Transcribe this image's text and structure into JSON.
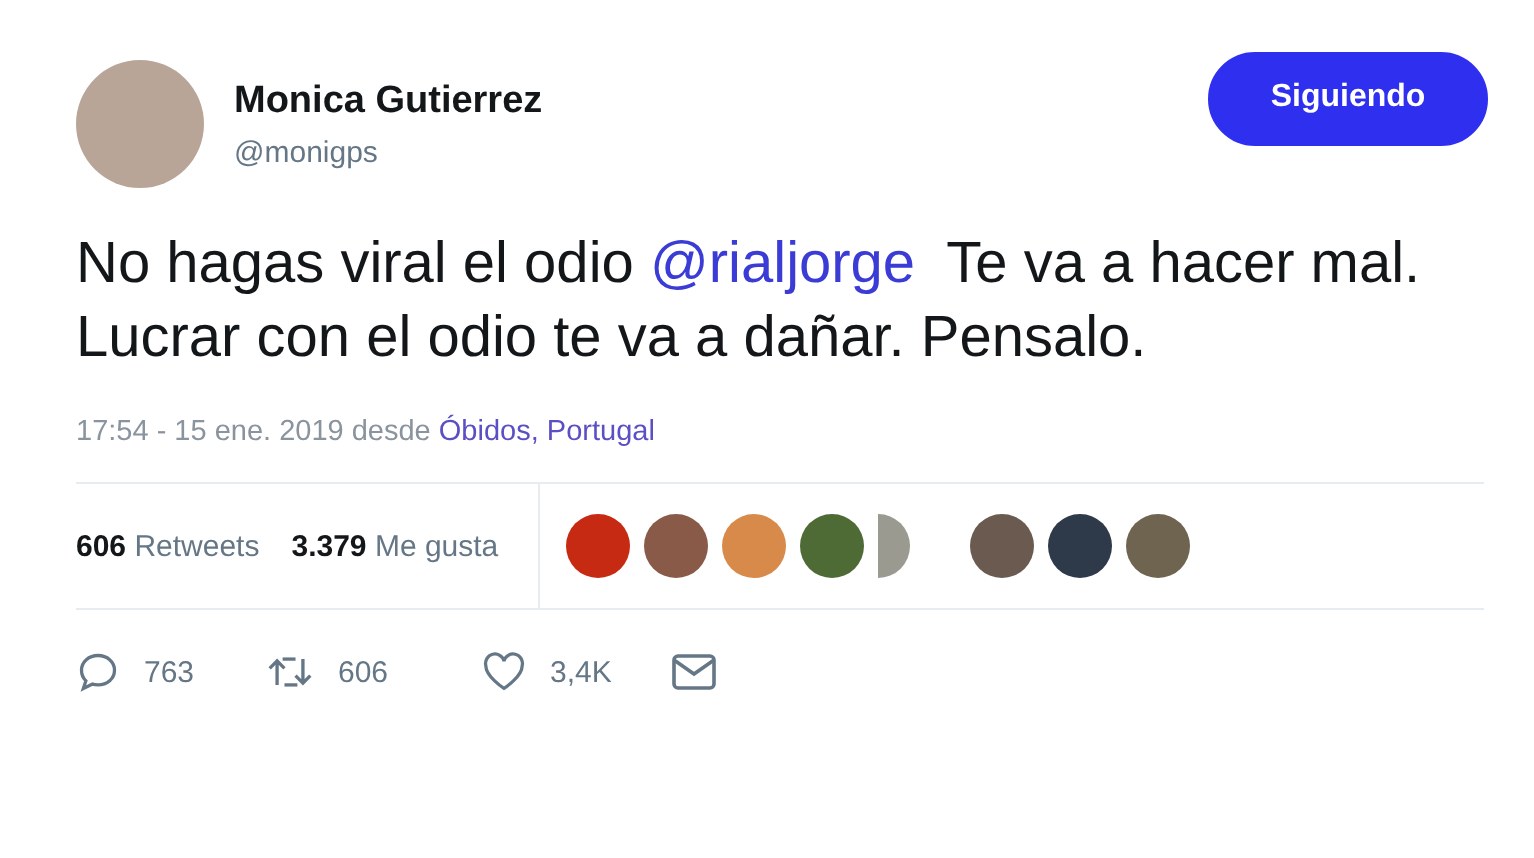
{
  "author": {
    "name": "Monica Gutierrez",
    "handle": "@monigps"
  },
  "follow_button": {
    "label": "Siguiendo",
    "selected": true
  },
  "tweet": {
    "parts": [
      {
        "kind": "text",
        "text": "No hagas viral el odio "
      },
      {
        "kind": "mention",
        "text": "@rialjorge"
      },
      {
        "kind": "text",
        "text": "  Te va a hacer mal. Lucrar con el odio te va a dañar. Pensalo."
      }
    ]
  },
  "meta": {
    "time": "17:54 - 15 ene. 2019 desde ",
    "location": "Óbidos, Portugal"
  },
  "stats": [
    {
      "count": "606",
      "label": "Retweets"
    },
    {
      "count": "3.379",
      "label": "Me gusta"
    }
  ],
  "actions": [
    {
      "kind": "reply",
      "count": "763"
    },
    {
      "kind": "retweet",
      "count": "606"
    },
    {
      "kind": "like",
      "count": "3,4K"
    },
    {
      "kind": "message"
    }
  ]
}
